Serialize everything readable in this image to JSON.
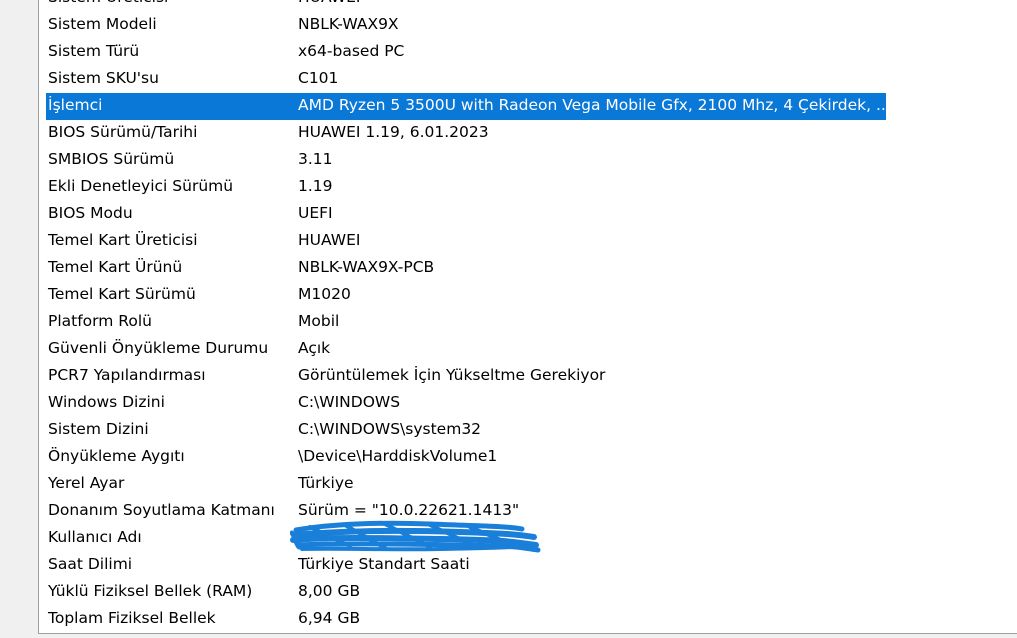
{
  "rows": [
    {
      "item": "Sistem Üreticisi",
      "value": "HUAWEI"
    },
    {
      "item": "Sistem Modeli",
      "value": "NBLK-WAX9X"
    },
    {
      "item": "Sistem Türü",
      "value": "x64-based PC"
    },
    {
      "item": "Sistem SKU'su",
      "value": "C101"
    },
    {
      "item": "İşlemci",
      "value": "AMD Ryzen 5 3500U with Radeon Vega Mobile Gfx, 2100 Mhz, 4 Çekirdek, ..."
    },
    {
      "item": "BIOS Sürümü/Tarihi",
      "value": "HUAWEI 1.19, 6.01.2023"
    },
    {
      "item": "SMBIOS Sürümü",
      "value": "3.11"
    },
    {
      "item": "Ekli Denetleyici Sürümü",
      "value": "1.19"
    },
    {
      "item": "BIOS Modu",
      "value": "UEFI"
    },
    {
      "item": "Temel Kart Üreticisi",
      "value": "HUAWEI"
    },
    {
      "item": "Temel Kart Ürünü",
      "value": "NBLK-WAX9X-PCB"
    },
    {
      "item": "Temel Kart Sürümü",
      "value": "M1020"
    },
    {
      "item": "Platform Rolü",
      "value": "Mobil"
    },
    {
      "item": "Güvenli Önyükleme Durumu",
      "value": "Açık"
    },
    {
      "item": "PCR7 Yapılandırması",
      "value": "Görüntülemek İçin Yükseltme Gerekiyor"
    },
    {
      "item": "Windows Dizini",
      "value": "C:\\WINDOWS"
    },
    {
      "item": "Sistem Dizini",
      "value": "C:\\WINDOWS\\system32"
    },
    {
      "item": "Önyükleme Aygıtı",
      "value": "\\Device\\HarddiskVolume1"
    },
    {
      "item": "Yerel Ayar",
      "value": "Türkiye"
    },
    {
      "item": "Donanım Soyutlama Katmanı",
      "value": "Sürüm = \"10.0.22621.1413\""
    },
    {
      "item": "Kullanıcı Adı",
      "value": ""
    },
    {
      "item": "Saat Dilimi",
      "value": "Türkiye Standart Saati"
    },
    {
      "item": "Yüklü Fiziksel Bellek (RAM)",
      "value": "8,00 GB"
    },
    {
      "item": "Toplam Fiziksel Bellek",
      "value": "6,94 GB"
    }
  ],
  "selected_index": 4,
  "colors": {
    "selection": "#0a78d7",
    "redaction": "#1a7fd8"
  }
}
